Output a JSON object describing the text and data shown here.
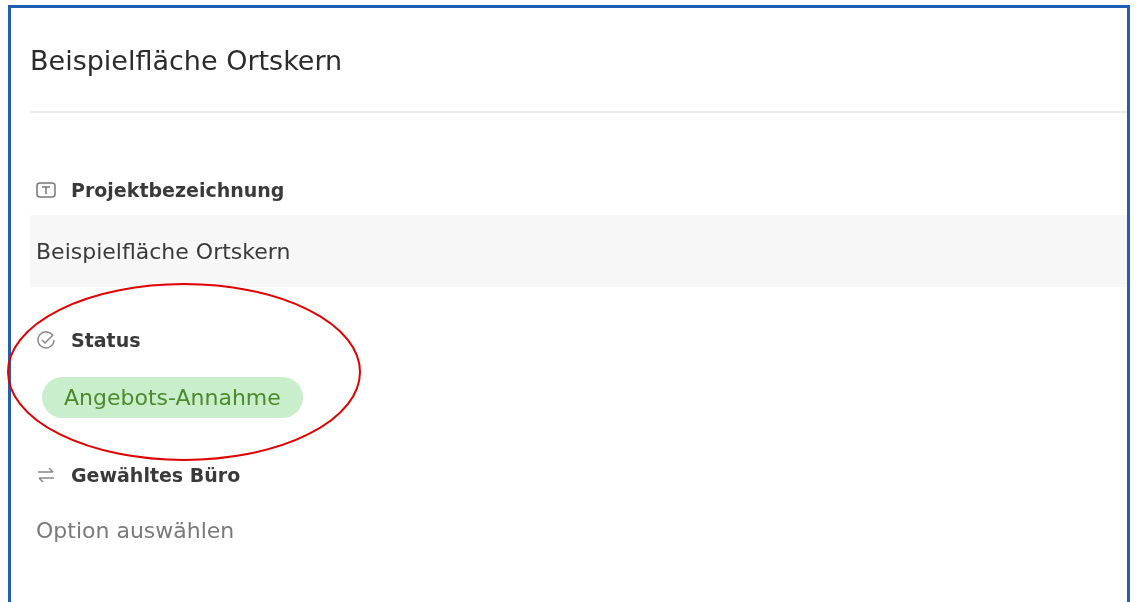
{
  "record": {
    "title": "Beispielfläche Ortskern"
  },
  "fields": [
    {
      "kind": "text",
      "label": "Projektbezeichnung",
      "value": "Beispielfläche Ortskern"
    },
    {
      "kind": "status",
      "label": "Status",
      "value": "Angebots-Annahme",
      "color": "#c9eecb"
    },
    {
      "kind": "select",
      "label": "Gewähltes Büro",
      "placeholder": "Option auswählen"
    }
  ]
}
